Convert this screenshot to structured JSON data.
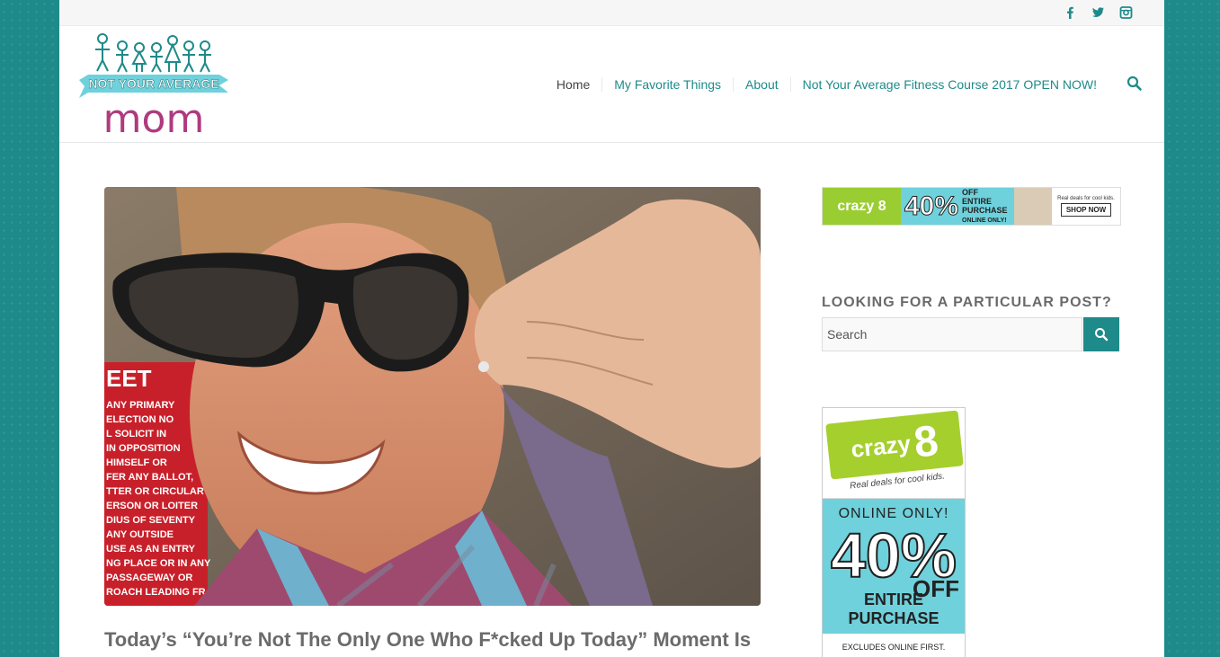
{
  "topbar": {
    "social": [
      "f",
      "t",
      "ig"
    ]
  },
  "brand": {
    "logo_top": "NOT YOUR AVERAGE",
    "logo_bottom": "mom"
  },
  "nav": {
    "items": [
      {
        "label": "Home"
      },
      {
        "label": "My Favorite Things"
      },
      {
        "label": "About"
      },
      {
        "label": "Not Your Average Fitness Course 2017 OPEN NOW!"
      }
    ]
  },
  "post": {
    "title": "Today’s “You’re Not The Only One Who F*cked Up Today” Moment Is"
  },
  "sidebar": {
    "banner_ad": {
      "brand": "crazy 8",
      "percent": "40%",
      "off": "OFF",
      "offer": "ENTIRE PURCHASE",
      "online": "ONLINE ONLY!",
      "tagline": "Real deals for cool kids.",
      "button": "SHOP NOW"
    },
    "search_widget": {
      "title": "LOOKING FOR A PARTICULAR POST?",
      "placeholder": "Search"
    },
    "tall_ad": {
      "brand": "crazy",
      "brand_number": "8",
      "tagline": "Real deals for cool kids.",
      "online": "ONLINE ONLY!",
      "percent": "40%",
      "off": "OFF",
      "offer": "ENTIRE PURCHASE",
      "excludes": "EXCLUDES ONLINE FIRST."
    }
  },
  "colors": {
    "accent": "#1f8a8a",
    "text": "#444444",
    "ad_green": "#a5cf2d",
    "ad_blue": "#6fd1dc"
  }
}
